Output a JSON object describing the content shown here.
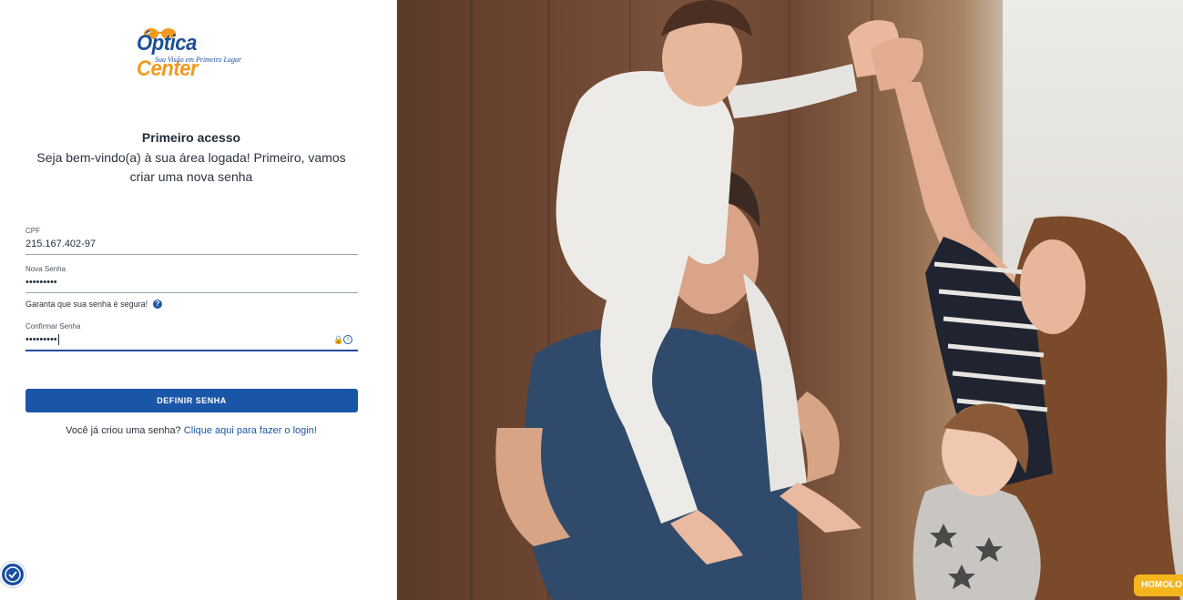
{
  "logo": {
    "brand_first": "Óptica",
    "brand_second": "Center",
    "tagline": "Sua Visão em Primeiro Lugar"
  },
  "heading": "Primeiro acesso",
  "subheading": "Seja bem-vindo(a) à sua área logada! Primeiro, vamos criar uma nova senha",
  "form": {
    "cpf_label": "CPF",
    "cpf_value": "215.167.402-97",
    "new_password_label": "Nova Senha",
    "new_password_value": "•••••••••",
    "password_hint": "Garanta que sua senha é segura!",
    "confirm_label": "Confirmar Senha",
    "confirm_value": "•••••••••",
    "submit_label": "DEFINIR SENHA"
  },
  "login_prompt": {
    "text": "Você já criou uma senha?",
    "link": "Clique aqui para fazer o login!"
  },
  "icons": {
    "help": "question-circle-icon",
    "lock": "lock-icon",
    "info": "info-icon",
    "accessibility": "accessibility-icon"
  },
  "environment_badge": "HOMOLO",
  "colors": {
    "primary": "#1a56a8",
    "brand_orange": "#f29a1f",
    "badge": "#f5b51c"
  }
}
